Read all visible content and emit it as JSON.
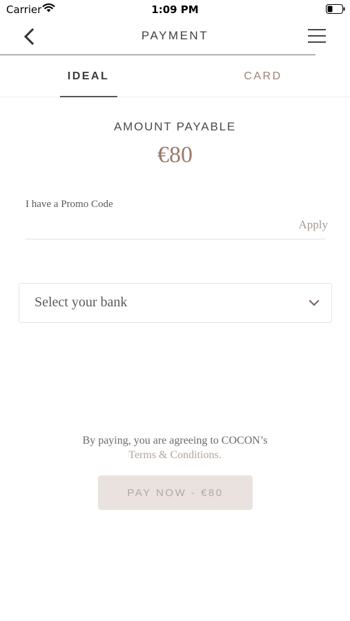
{
  "status_bar": {
    "carrier": "Carrier",
    "time": "1:09 PM",
    "wifi_icon": "wifi-icon",
    "battery_icon": "battery-low-icon"
  },
  "nav": {
    "title": "PAYMENT",
    "back_icon": "chevron-left-icon",
    "menu_icon": "hamburger-menu-icon"
  },
  "tabs": [
    {
      "label": "IDEAL",
      "active": true
    },
    {
      "label": "CARD",
      "active": false
    }
  ],
  "amount": {
    "label": "AMOUNT PAYABLE",
    "value": "€80"
  },
  "promo": {
    "label": "I have a Promo Code",
    "value": "",
    "apply_label": "Apply"
  },
  "bank": {
    "placeholder": "Select your bank"
  },
  "terms": {
    "text": "By paying, you are agreeing to COCON’s",
    "link": "Terms & Conditions."
  },
  "pay_button": {
    "label": "PAY NOW - €80"
  },
  "colors": {
    "accent": "#9b7a6c",
    "pay_button_bg": "#e9e2de",
    "tab_inactive": "#9b8176"
  }
}
